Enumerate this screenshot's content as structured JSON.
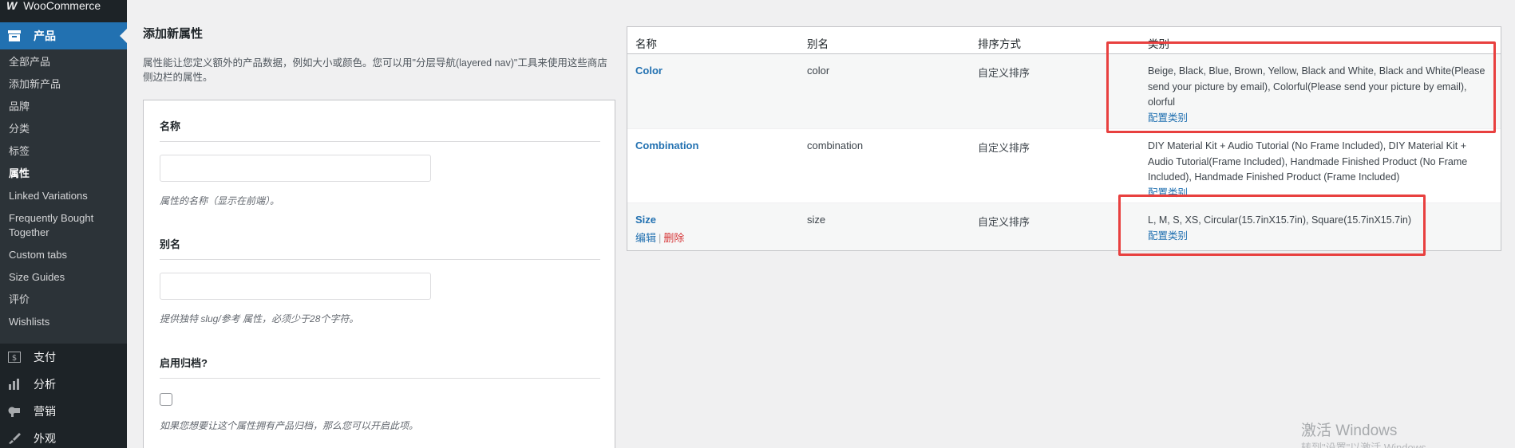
{
  "sidebar": {
    "top_label": "WooCommerce",
    "current_section": "产品",
    "submenu": [
      {
        "label": "全部产品"
      },
      {
        "label": "添加新产品"
      },
      {
        "label": "品牌"
      },
      {
        "label": "分类"
      },
      {
        "label": "标签"
      },
      {
        "label": "属性"
      },
      {
        "label": "Linked Variations"
      },
      {
        "label": "Frequently Bought Together"
      },
      {
        "label": "Custom tabs"
      },
      {
        "label": "Size Guides"
      },
      {
        "label": "评价"
      },
      {
        "label": "Wishlists"
      }
    ],
    "main_items": [
      {
        "label": "支付",
        "icon": "dollar-icon"
      },
      {
        "label": "分析",
        "icon": "bar-chart-icon"
      },
      {
        "label": "营销",
        "icon": "megaphone-icon"
      },
      {
        "label": "外观",
        "icon": "brush-icon"
      }
    ]
  },
  "form": {
    "title": "添加新属性",
    "description": "属性能让您定义额外的产品数据，例如大小或颜色。您可以用\"分层导航(layered nav)\"工具来使用这些商店侧边栏的属性。",
    "name_label": "名称",
    "name_value": "",
    "name_hint": "属性的名称（显示在前端）。",
    "slug_label": "别名",
    "slug_value": "",
    "slug_hint": "提供独特 slug/参考 属性，必须少于28个字符。",
    "archive_label": "启用归档?",
    "archive_hint": "如果您想要让这个属性拥有产品归档，那么您可以开启此项。"
  },
  "table": {
    "headers": [
      "名称",
      "别名",
      "排序方式",
      "类别"
    ],
    "rows": [
      {
        "name": "Color",
        "slug": "color",
        "order": "自定义排序",
        "terms": "Beige, Black, Blue, Brown, Yellow, Black and White, Black and White(Please send your picture by email), Colorful(Please send your picture by email), olorful",
        "configure": "配置类别"
      },
      {
        "name": "Combination",
        "slug": "combination",
        "order": "自定义排序",
        "terms": "DIY Material Kit + Audio Tutorial (No Frame Included), DIY Material Kit + Audio Tutorial(Frame Included), Handmade Finished Product (No Frame Included), Handmade Finished Product (Frame Included)",
        "configure": "配置类别"
      },
      {
        "name": "Size",
        "slug": "size",
        "order": "自定义排序",
        "terms": "L, M, S, XS, Circular(15.7inX15.7in), Square(15.7inX15.7in)",
        "configure": "配置类别",
        "edit_label": "编辑",
        "delete_label": "删除"
      }
    ]
  },
  "watermark": {
    "line1": "激活 Windows",
    "line2": "转到\"设置\"以激活 Windows。"
  },
  "colors": {
    "sidebar_bg": "#1d2327",
    "accent": "#2271b1",
    "highlight": "#e8403f",
    "delete": "#d63638"
  }
}
